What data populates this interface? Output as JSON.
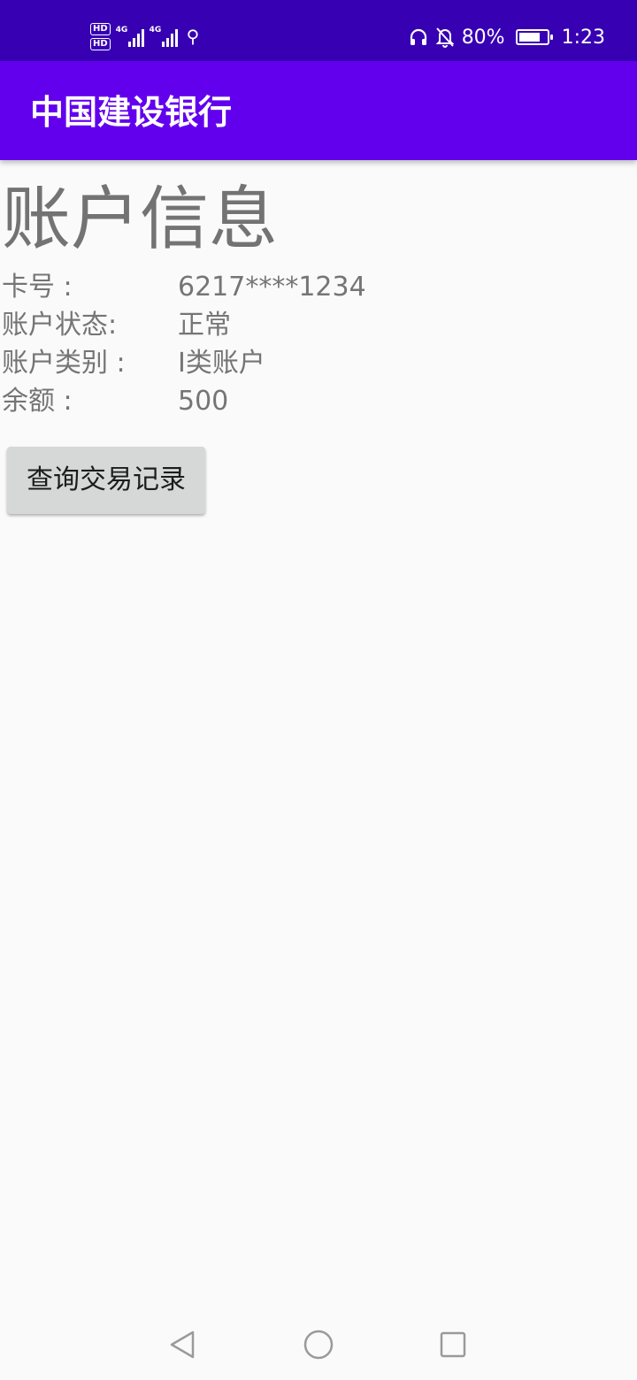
{
  "status_bar": {
    "hd_top": "HD",
    "hd_bottom": "HD",
    "network1": "4G",
    "network2": "4G",
    "battery_percent": "80%",
    "battery_level": 0.8,
    "time": "1:23",
    "icons": [
      "hd-icon",
      "signal-icon",
      "usb-icon",
      "headset-icon",
      "bell-off-icon",
      "battery-charging-icon"
    ]
  },
  "toolbar": {
    "title": "中国建设银行",
    "background": "#6200ee"
  },
  "account": {
    "heading": "账户信息",
    "rows": [
      {
        "label": "卡号 :",
        "value": "6217****1234"
      },
      {
        "label": "账户状态:",
        "value": "正常"
      },
      {
        "label": "账户类别 :",
        "value": "I类账户"
      },
      {
        "label": "余额 :",
        "value": "500"
      }
    ]
  },
  "actions": {
    "query_label": "查询交易记录"
  },
  "nav": {
    "icons": [
      "back-icon",
      "home-icon",
      "recent-apps-icon"
    ]
  },
  "colors": {
    "status_bar": "#3700b3",
    "accent": "#6200ee",
    "text_gray": "#757575"
  }
}
